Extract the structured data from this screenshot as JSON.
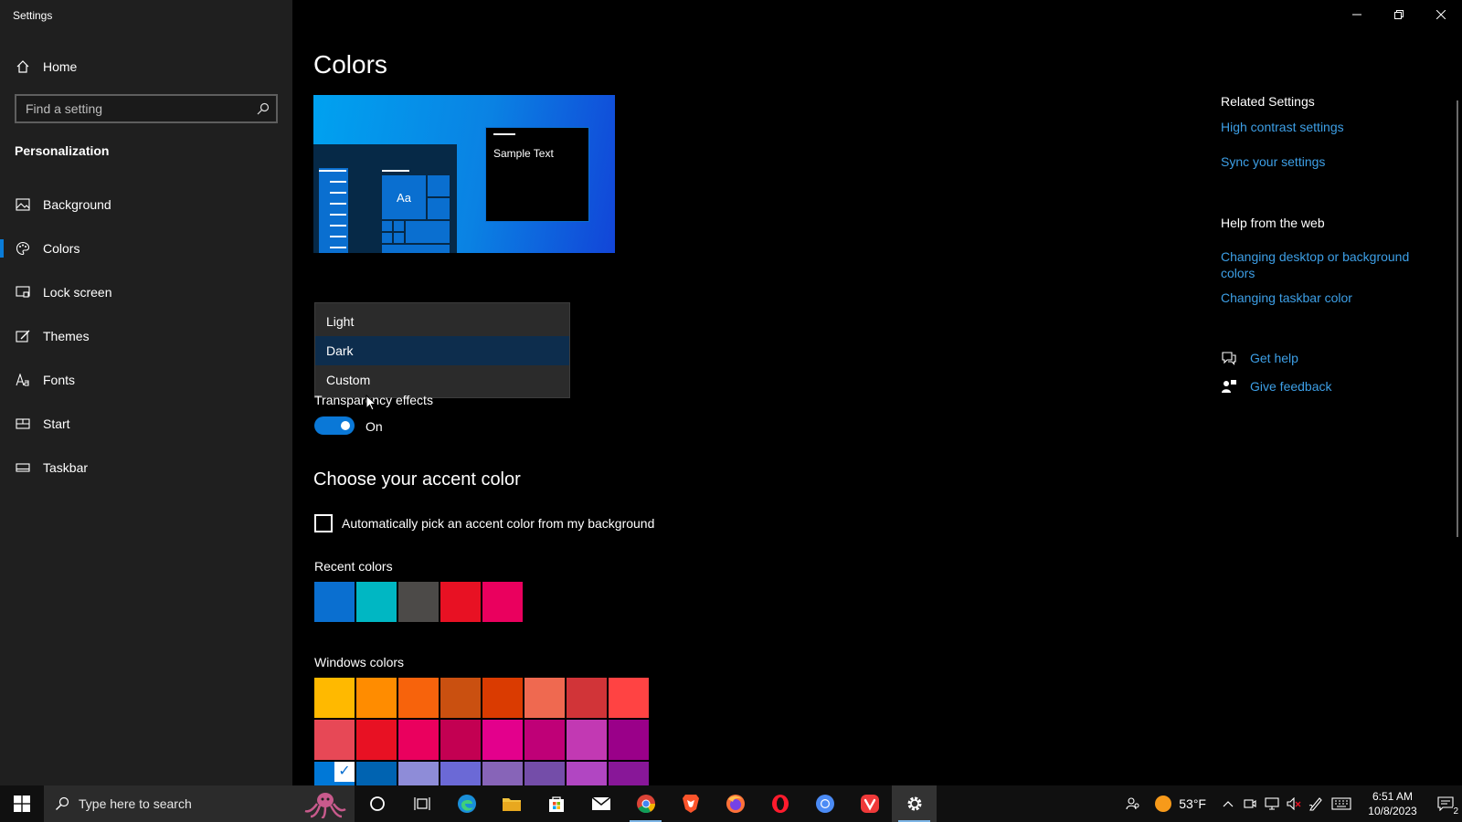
{
  "window": {
    "title": "Settings"
  },
  "sidebar": {
    "home_label": "Home",
    "search_placeholder": "Find a setting",
    "section_title": "Personalization",
    "items": [
      {
        "label": "Background",
        "icon": "image-icon"
      },
      {
        "label": "Colors",
        "icon": "palette-icon",
        "active": true
      },
      {
        "label": "Lock screen",
        "icon": "lock-screen-icon"
      },
      {
        "label": "Themes",
        "icon": "brush-icon"
      },
      {
        "label": "Fonts",
        "icon": "font-icon"
      },
      {
        "label": "Start",
        "icon": "start-menu-icon"
      },
      {
        "label": "Taskbar",
        "icon": "taskbar-icon"
      }
    ]
  },
  "main": {
    "title": "Colors",
    "preview": {
      "sample_text": "Sample Text",
      "tile_text": "Aa"
    },
    "mode_dropdown": {
      "options": [
        "Light",
        "Dark",
        "Custom"
      ],
      "selected": "Dark"
    },
    "transparency": {
      "label": "Transparency effects",
      "state": "On"
    },
    "accent": {
      "title": "Choose your accent color",
      "auto_pick_label": "Automatically pick an accent color from my background",
      "recent_label": "Recent colors",
      "recent_colors": [
        "#0a6fd0",
        "#00b7c3",
        "#4c4a48",
        "#e81123",
        "#ea005e"
      ],
      "windows_label": "Windows colors",
      "windows_colors": [
        "#ffb900",
        "#ff8c00",
        "#f7630c",
        "#ca5010",
        "#da3b01",
        "#ef6950",
        "#d13438",
        "#ff4343",
        "#e74856",
        "#e81123",
        "#ea005e",
        "#c30052",
        "#e3008c",
        "#bf0077",
        "#c239b3",
        "#9a0089",
        "#0078d7",
        "#0063b1",
        "#8e8cd8",
        "#6b69d6",
        "#8764b8",
        "#744da9",
        "#b146c2",
        "#881798"
      ]
    }
  },
  "related": {
    "heading": "Related Settings",
    "links": [
      "High contrast settings",
      "Sync your settings"
    ],
    "help_heading": "Help from the web",
    "help_links": [
      "Changing desktop or background colors",
      "Changing taskbar color"
    ],
    "get_help": "Get help",
    "give_feedback": "Give feedback"
  },
  "taskbar": {
    "search_placeholder": "Type here to search",
    "weather": "53°F",
    "time": "6:51 AM",
    "date": "10/8/2023",
    "notification_count": "2"
  }
}
